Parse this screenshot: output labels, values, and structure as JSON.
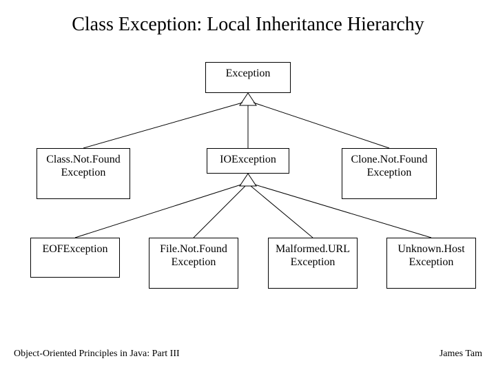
{
  "title": "Class Exception: Local Inheritance Hierarchy",
  "nodes": {
    "exception": "Exception",
    "classNotFound": "Class.Not.Found Exception",
    "ioException": "IOException",
    "cloneNotFound": "Clone.Not.Found Exception",
    "eofException": "EOFException",
    "fileNotFound": "File.Not.Found Exception",
    "malformedUrl": "Malformed.URL Exception",
    "unknownHost": "Unknown.Host Exception"
  },
  "footer": {
    "left": "Object-Oriented Principles in Java: Part III",
    "right": "James Tam"
  }
}
